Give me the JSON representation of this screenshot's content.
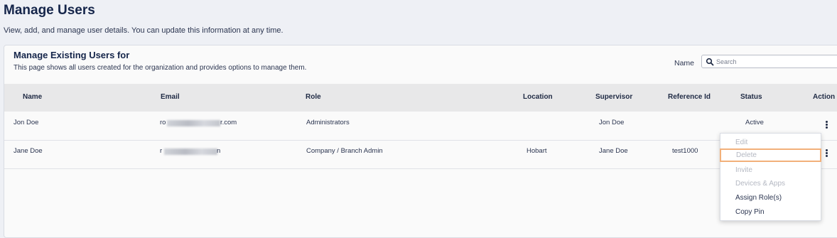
{
  "header": {
    "title": "Manage Users",
    "subtitle": "View, add, and manage user details. You can update this information at any time."
  },
  "card": {
    "title": "Manage Existing Users for",
    "subtitle": "This page shows all users created for the organization and provides options to manage them.",
    "name_filter_label": "Name",
    "search_placeholder": "Search"
  },
  "table": {
    "columns": [
      "Name",
      "Email",
      "Role",
      "Location",
      "Supervisor",
      "Reference Id",
      "Status",
      "Action"
    ],
    "rows": [
      {
        "name": "Jon Doe",
        "email_prefix": "ro",
        "email_suffix": "r.com",
        "role": "Administrators",
        "location": "",
        "supervisor": "Jon Doe",
        "reference_id": "",
        "status": "Active"
      },
      {
        "name": "Jane Doe",
        "email_prefix": "r",
        "email_suffix": "n",
        "role": "Company / Branch Admin",
        "location": "Hobart",
        "supervisor": "Jane Doe",
        "reference_id": "test1000",
        "status": ""
      }
    ]
  },
  "action_menu": {
    "items": [
      {
        "label": "Edit",
        "enabled": false
      },
      {
        "label": "Delete",
        "enabled": false,
        "highlighted": true
      },
      {
        "label": "Invite",
        "enabled": false
      },
      {
        "label": "Devices & Apps",
        "enabled": false
      },
      {
        "label": "Assign Role(s)",
        "enabled": true
      },
      {
        "label": "Copy Pin",
        "enabled": true
      }
    ]
  },
  "colors": {
    "page_bg": "#eef0f5",
    "title": "#15254a",
    "header_row_bg": "#e8e8e9",
    "highlight_border": "#f2b07a"
  }
}
